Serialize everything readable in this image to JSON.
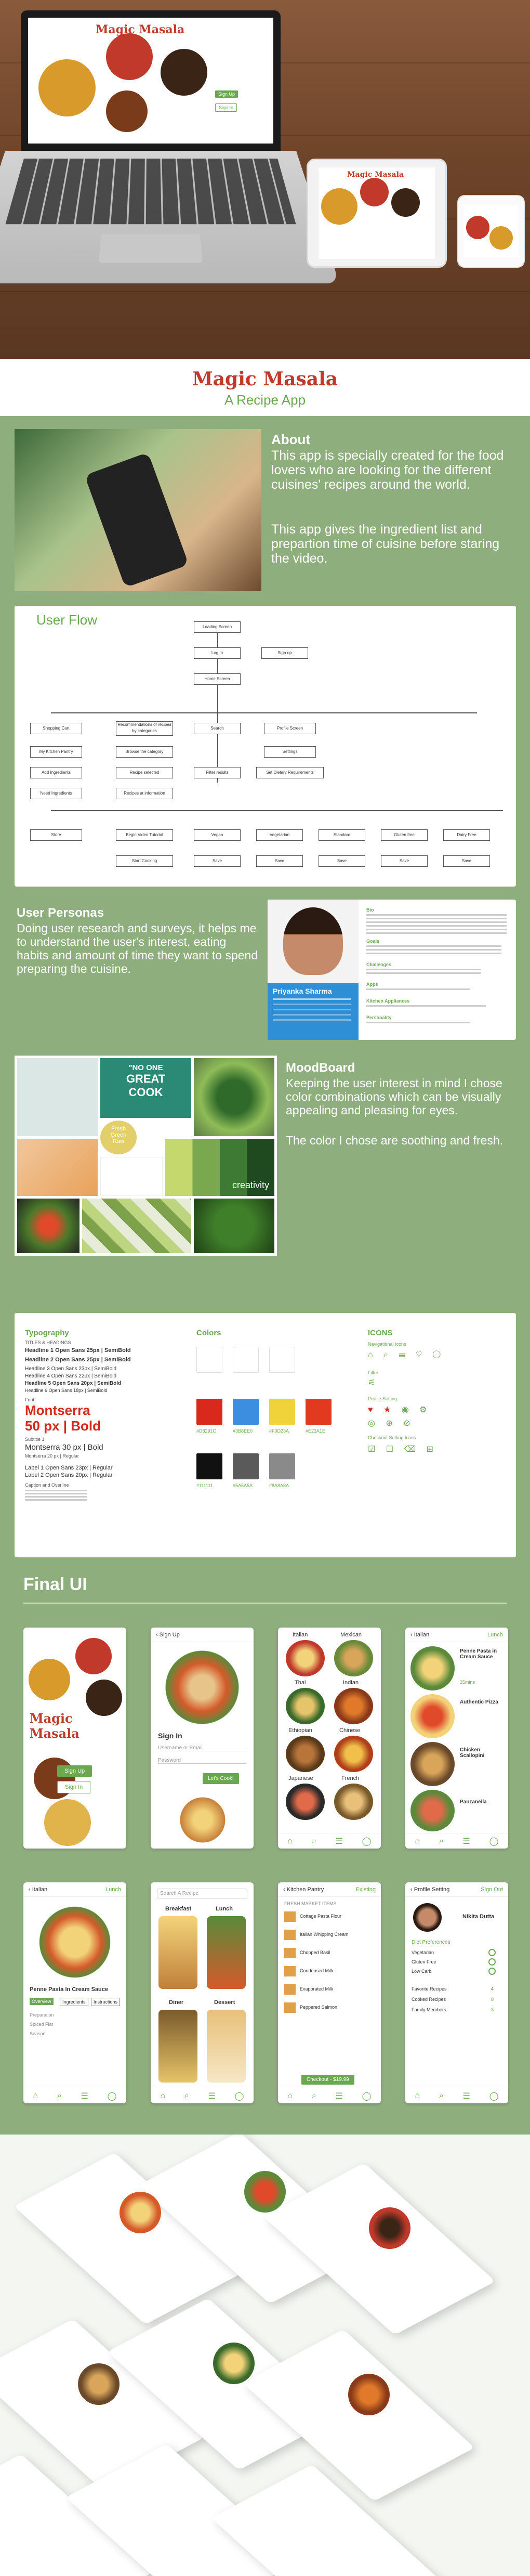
{
  "hero": {
    "laptop_title": "Magic Masala",
    "laptop_signup": "Sign Up",
    "laptop_signin": "Sign In",
    "tablet_title": "Magic Masala"
  },
  "title": {
    "app_name": "Magic Masala",
    "subtitle": "A Recipe App"
  },
  "about": {
    "heading": "About",
    "para1": "This app is specially created for the food lovers who are looking for the different cuisines' recipes around the world.",
    "para2": "This app gives the ingredient list and prepartion time of cuisine before staring the video."
  },
  "user_flow": {
    "heading": "User Flow",
    "nodes": [
      "Loading Screen",
      "Log In",
      "Sign up",
      "Home Screen",
      "Shopping Cart",
      "Recommendations of recipes by categories",
      "Search",
      "Profile Screen",
      "My Kitchen Pantry",
      "Browse the category",
      "Settings",
      "Add Ingredients",
      "Recipe selected",
      "Filter results",
      "Set Dietary Requirements",
      "Need Ingredients",
      "Recipes at information",
      "Store",
      "Begin Video Tutorial",
      "Start Cooking",
      "Vegan",
      "Vegetarian",
      "Standard",
      "Gluten free",
      "Dairy Free",
      "Save",
      "Save",
      "Save",
      "Save",
      "Save"
    ]
  },
  "personas": {
    "heading": "User  Personas",
    "text": "Doing user research and surveys, it helps me to understand the user's interest, eating habits and amount of time they want to spend preparing the cuisine.",
    "name": "Priyanka Sharma",
    "bio_label": "Bio",
    "goals_label": "Goals",
    "challenges_label": "Challenges",
    "apps_label": "Apps",
    "kitchen_label": "Kitchen Appliances",
    "personality_label": "Personality"
  },
  "moodboard": {
    "heading": "MoodBoard",
    "para1": "Keeping the user interest in mind I chose color combinations which can be visually appealing and pleasing for eyes.",
    "para2": "The color I chose are soothing and fresh.",
    "tile_no_one": "\"NO ONE",
    "tile_great": "GREAT",
    "tile_cook": "COOK",
    "tile_fresh": "Fresh",
    "tile_green": "Green",
    "tile_raw": "Raw",
    "tile_creativity": "creativity"
  },
  "style_guide": {
    "typography_heading": "Typography",
    "titles_label": "TITLES & HEADINGS",
    "h1": "Headline 1  Open Sans  25px | SemiBold",
    "h2": "Headline 2  Open Sans  25px | SemiBold",
    "h3": "Headline 3  Open Sans 23px | SemiBold",
    "h4": "Headline 4 Open Sans 22px | SemiBold",
    "h5": "Headline 5 Open Sans 20px | SemiBold",
    "h6": "Headline 6 Open Sans 18px | SemiBold",
    "font_label": "Font",
    "font_name": "Montserra",
    "font_spec": "50 px | Bold",
    "sub_label": "Subtitle 1",
    "sub_font": "Montserra       30 px | Bold",
    "sub_font2": "Montserra       20 px | Regular",
    "label1": "Label 1     Open Sans    23px | Regular",
    "label2": "Label 2     Open Sans    20px | Regular",
    "caption": "Caption and Overline",
    "colors_heading": "Colors",
    "icons_heading": "ICONS",
    "nav_icons": "Navigational Icons",
    "filter_label": "Filter",
    "profile_setting": "Profile Setting",
    "checkout_setting": "Checkout Setting Icons",
    "colors": [
      "#ffffff",
      "#ffffff",
      "#ffffff",
      "#d8291c",
      "#3b8ee0",
      "#f0d23a",
      "#e23a1e",
      "#111111",
      "#5a5a5a",
      "#8a8a8a"
    ],
    "color_codes": [
      "#FFFFFF",
      "#FAFAFA",
      "#F6F6F6",
      "#D8291C",
      "#3B8EE0",
      "#F0D23A",
      "#E23A1E",
      "#111111",
      "#5A5A5A",
      "#8A8A8A"
    ]
  },
  "final_ui": {
    "heading": "Final UI",
    "s1_title": "Magic Masala",
    "s1_signup": "Sign Up",
    "s1_signin": "Sign In",
    "s2_header": "Sign Up",
    "s2_signin": "Sign In",
    "s2_user": "Username or Email",
    "s2_pass": "Password",
    "s2_btn": "Let's Cook!",
    "s3_items": [
      "Italian",
      "Mexican",
      "Thai",
      "Indian",
      "Ethiopian",
      "Chinese",
      "Japanese",
      "French"
    ],
    "s4_header": "Italian",
    "s4_tab": "Lunch",
    "s4_items": [
      "Penne Pasta in Cream Sauce",
      "Authentic Pizza",
      "Chicken Scallopini",
      "Panzanella"
    ],
    "s4_time": "25mins",
    "s5_header": "Italian",
    "s5_tab": "Lunch",
    "s5_title": "Penne Pasta In Cream Sauce",
    "s5_tabs": [
      "Overview",
      "Ingredients",
      "Instructions"
    ],
    "s5_lines": [
      "Preparation",
      "Spiced Flat",
      "Season"
    ],
    "s6_search": "Search A Recipe",
    "s6_items": [
      "Breakfast",
      "Lunch",
      "Diner",
      "Dessert"
    ],
    "s7_header": "Kitchen Pantry",
    "s7_tab": "Existing",
    "s7_sub": "FRESH MARKET ITEMS",
    "s7_items": [
      "Cottage Pasta Flour",
      "Italian Whipping Cream",
      "Chopped Basil",
      "Condensed Milk",
      "Evaporated Milk",
      "Peppered Salmon"
    ],
    "s7_btn": "Checkout - $19.99",
    "s8_header": "Profile Setting",
    "s8_tab": "Sign Out",
    "s8_name": "Nikita Dutta",
    "s8_pref": "Diet Preferences",
    "s8_opts": [
      "Vegetarian",
      "Gluten Free",
      "Low Carb"
    ],
    "s8_rows": [
      "Favorite Recipes",
      "Cooked Recipes",
      "Family Members"
    ],
    "s8_counts": [
      "4",
      "8",
      "3"
    ]
  }
}
